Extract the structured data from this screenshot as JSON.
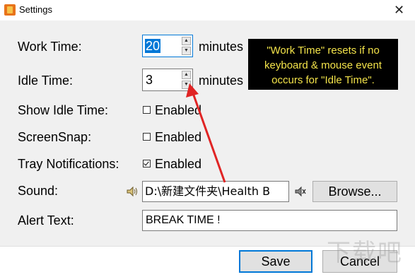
{
  "window": {
    "title": "Settings",
    "close_glyph": "✕"
  },
  "fields": {
    "work_time": {
      "label": "Work Time:",
      "value": "20",
      "unit": "minutes"
    },
    "idle_time": {
      "label": "Idle Time:",
      "value": "3",
      "unit": "minutes"
    },
    "show_idle_time": {
      "label": "Show Idle Time:",
      "option": "Enabled",
      "checked": false
    },
    "screen_snap": {
      "label": "ScreenSnap:",
      "option": "Enabled",
      "checked": false
    },
    "tray_notifications": {
      "label": "Tray Notifications:",
      "option": "Enabled",
      "checked": true
    },
    "sound": {
      "label": "Sound:",
      "path": "D:\\新建文件夹\\Health B",
      "browse_label": "Browse..."
    },
    "alert_text": {
      "label": "Alert Text:",
      "value": "BREAK TIME !"
    }
  },
  "tooltip": {
    "line1": "\"Work Time\" resets if no",
    "line2": "keyboard & mouse event",
    "line3": "occurs for \"Idle Time\"."
  },
  "buttons": {
    "save": "Save",
    "cancel": "Cancel"
  },
  "watermark": "下载吧",
  "colors": {
    "accent": "#0078d7",
    "tooltip_text": "#f3e34a",
    "annotation_arrow": "#e02424"
  }
}
